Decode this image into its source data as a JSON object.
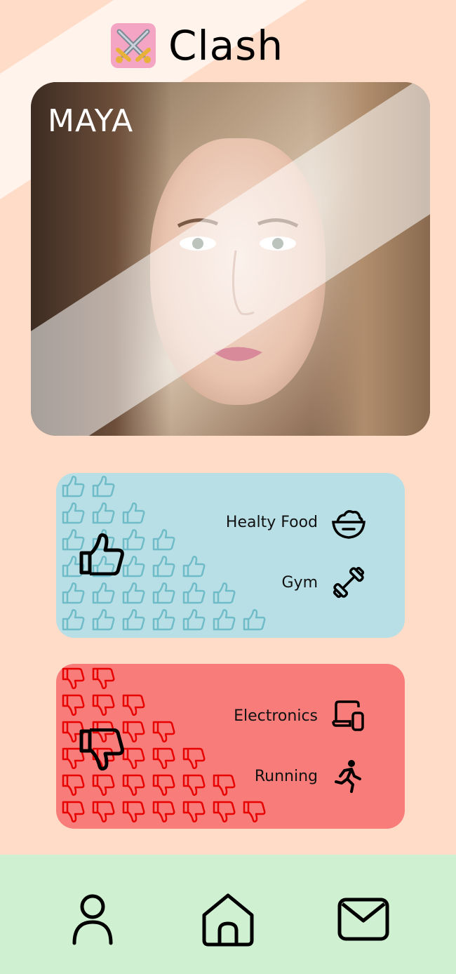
{
  "app": {
    "title": "Clash",
    "logo_icon": "crossed-swords-icon"
  },
  "profile": {
    "name": "MAYA"
  },
  "likes": {
    "items": [
      {
        "label": "Healty Food",
        "icon": "salad-bowl-icon"
      },
      {
        "label": "Gym",
        "icon": "dumbbell-icon"
      }
    ],
    "color": "#b8dfe5",
    "pattern_color": "#6fbcc8"
  },
  "dislikes": {
    "items": [
      {
        "label": "Electronics",
        "icon": "devices-icon"
      },
      {
        "label": "Running",
        "icon": "running-person-icon"
      }
    ],
    "color": "#f77c7a",
    "pattern_color": "#e80000"
  },
  "nav": {
    "items": [
      {
        "name": "profile",
        "icon": "user-icon"
      },
      {
        "name": "home",
        "icon": "home-icon"
      },
      {
        "name": "messages",
        "icon": "mail-icon"
      }
    ],
    "background": "#d0f0d2"
  }
}
